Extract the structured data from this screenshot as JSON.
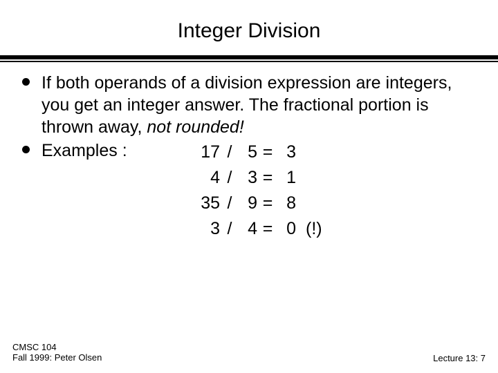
{
  "title": "Integer Division",
  "bullets": {
    "para1_a": "If both operands of a division expression are integers, you get an integer answer. The fractional portion is thrown away, ",
    "para1_em": "not rounded!",
    "examples_label": "Examples :"
  },
  "examples": [
    {
      "a": "17",
      "op": "/",
      "b": "5",
      "eq": "=",
      "r": "3",
      "x": ""
    },
    {
      "a": "4",
      "op": "/",
      "b": "3",
      "eq": "=",
      "r": "1",
      "x": ""
    },
    {
      "a": "35",
      "op": "/",
      "b": "9",
      "eq": "=",
      "r": "8",
      "x": ""
    },
    {
      "a": "3",
      "op": "/",
      "b": "4",
      "eq": "=",
      "r": "0",
      "x": "(!)"
    }
  ],
  "footer": {
    "course": "CMSC 104",
    "term": "Fall 1999: Peter Olsen",
    "lecture": "Lecture 13: 7"
  }
}
